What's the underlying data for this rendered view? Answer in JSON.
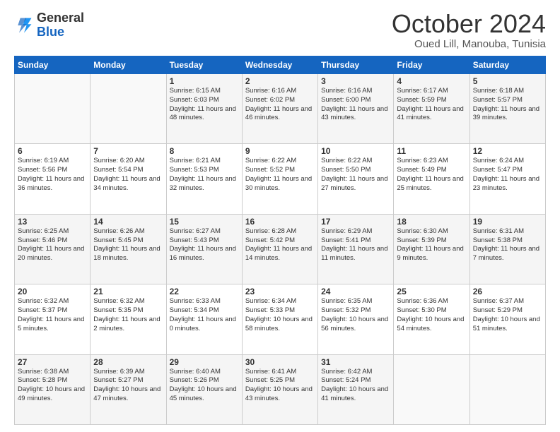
{
  "header": {
    "logo_line1": "General",
    "logo_line2": "Blue",
    "month_title": "October 2024",
    "location": "Oued Lill, Manouba, Tunisia"
  },
  "days_of_week": [
    "Sunday",
    "Monday",
    "Tuesday",
    "Wednesday",
    "Thursday",
    "Friday",
    "Saturday"
  ],
  "weeks": [
    [
      {
        "num": "",
        "text": ""
      },
      {
        "num": "",
        "text": ""
      },
      {
        "num": "1",
        "text": "Sunrise: 6:15 AM\nSunset: 6:03 PM\nDaylight: 11 hours and 48 minutes."
      },
      {
        "num": "2",
        "text": "Sunrise: 6:16 AM\nSunset: 6:02 PM\nDaylight: 11 hours and 46 minutes."
      },
      {
        "num": "3",
        "text": "Sunrise: 6:16 AM\nSunset: 6:00 PM\nDaylight: 11 hours and 43 minutes."
      },
      {
        "num": "4",
        "text": "Sunrise: 6:17 AM\nSunset: 5:59 PM\nDaylight: 11 hours and 41 minutes."
      },
      {
        "num": "5",
        "text": "Sunrise: 6:18 AM\nSunset: 5:57 PM\nDaylight: 11 hours and 39 minutes."
      }
    ],
    [
      {
        "num": "6",
        "text": "Sunrise: 6:19 AM\nSunset: 5:56 PM\nDaylight: 11 hours and 36 minutes."
      },
      {
        "num": "7",
        "text": "Sunrise: 6:20 AM\nSunset: 5:54 PM\nDaylight: 11 hours and 34 minutes."
      },
      {
        "num": "8",
        "text": "Sunrise: 6:21 AM\nSunset: 5:53 PM\nDaylight: 11 hours and 32 minutes."
      },
      {
        "num": "9",
        "text": "Sunrise: 6:22 AM\nSunset: 5:52 PM\nDaylight: 11 hours and 30 minutes."
      },
      {
        "num": "10",
        "text": "Sunrise: 6:22 AM\nSunset: 5:50 PM\nDaylight: 11 hours and 27 minutes."
      },
      {
        "num": "11",
        "text": "Sunrise: 6:23 AM\nSunset: 5:49 PM\nDaylight: 11 hours and 25 minutes."
      },
      {
        "num": "12",
        "text": "Sunrise: 6:24 AM\nSunset: 5:47 PM\nDaylight: 11 hours and 23 minutes."
      }
    ],
    [
      {
        "num": "13",
        "text": "Sunrise: 6:25 AM\nSunset: 5:46 PM\nDaylight: 11 hours and 20 minutes."
      },
      {
        "num": "14",
        "text": "Sunrise: 6:26 AM\nSunset: 5:45 PM\nDaylight: 11 hours and 18 minutes."
      },
      {
        "num": "15",
        "text": "Sunrise: 6:27 AM\nSunset: 5:43 PM\nDaylight: 11 hours and 16 minutes."
      },
      {
        "num": "16",
        "text": "Sunrise: 6:28 AM\nSunset: 5:42 PM\nDaylight: 11 hours and 14 minutes."
      },
      {
        "num": "17",
        "text": "Sunrise: 6:29 AM\nSunset: 5:41 PM\nDaylight: 11 hours and 11 minutes."
      },
      {
        "num": "18",
        "text": "Sunrise: 6:30 AM\nSunset: 5:39 PM\nDaylight: 11 hours and 9 minutes."
      },
      {
        "num": "19",
        "text": "Sunrise: 6:31 AM\nSunset: 5:38 PM\nDaylight: 11 hours and 7 minutes."
      }
    ],
    [
      {
        "num": "20",
        "text": "Sunrise: 6:32 AM\nSunset: 5:37 PM\nDaylight: 11 hours and 5 minutes."
      },
      {
        "num": "21",
        "text": "Sunrise: 6:32 AM\nSunset: 5:35 PM\nDaylight: 11 hours and 2 minutes."
      },
      {
        "num": "22",
        "text": "Sunrise: 6:33 AM\nSunset: 5:34 PM\nDaylight: 11 hours and 0 minutes."
      },
      {
        "num": "23",
        "text": "Sunrise: 6:34 AM\nSunset: 5:33 PM\nDaylight: 10 hours and 58 minutes."
      },
      {
        "num": "24",
        "text": "Sunrise: 6:35 AM\nSunset: 5:32 PM\nDaylight: 10 hours and 56 minutes."
      },
      {
        "num": "25",
        "text": "Sunrise: 6:36 AM\nSunset: 5:30 PM\nDaylight: 10 hours and 54 minutes."
      },
      {
        "num": "26",
        "text": "Sunrise: 6:37 AM\nSunset: 5:29 PM\nDaylight: 10 hours and 51 minutes."
      }
    ],
    [
      {
        "num": "27",
        "text": "Sunrise: 6:38 AM\nSunset: 5:28 PM\nDaylight: 10 hours and 49 minutes."
      },
      {
        "num": "28",
        "text": "Sunrise: 6:39 AM\nSunset: 5:27 PM\nDaylight: 10 hours and 47 minutes."
      },
      {
        "num": "29",
        "text": "Sunrise: 6:40 AM\nSunset: 5:26 PM\nDaylight: 10 hours and 45 minutes."
      },
      {
        "num": "30",
        "text": "Sunrise: 6:41 AM\nSunset: 5:25 PM\nDaylight: 10 hours and 43 minutes."
      },
      {
        "num": "31",
        "text": "Sunrise: 6:42 AM\nSunset: 5:24 PM\nDaylight: 10 hours and 41 minutes."
      },
      {
        "num": "",
        "text": ""
      },
      {
        "num": "",
        "text": ""
      }
    ]
  ]
}
